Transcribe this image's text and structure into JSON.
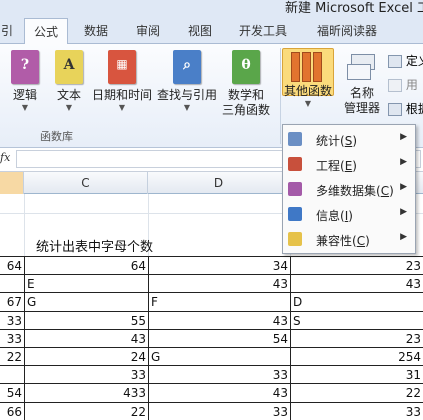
{
  "window": {
    "title": "新建 Microsoft Excel 工"
  },
  "tabs": [
    {
      "label": "引"
    },
    {
      "label": "公式"
    },
    {
      "label": "数据"
    },
    {
      "label": "审阅"
    },
    {
      "label": "视图"
    },
    {
      "label": "开发工具"
    },
    {
      "label": "福昕阅读器"
    }
  ],
  "ribbon": {
    "group_label": "函数库",
    "buttons": [
      {
        "label": "逻辑",
        "icon": "logic-book-icon",
        "glyph": "?"
      },
      {
        "label": "文本",
        "icon": "text-book-icon",
        "glyph": "A"
      },
      {
        "label": "日期和时间",
        "icon": "date-book-icon",
        "glyph": "▦"
      },
      {
        "label": "查找与引用",
        "icon": "lookup-book-icon",
        "glyph": "⌕"
      },
      {
        "label1": "数学和",
        "label2": "三角函数",
        "icon": "math-book-icon",
        "glyph": "θ"
      },
      {
        "label": "其他函数",
        "icon": "more-functions-icon"
      },
      {
        "label1": "名称",
        "label2": "管理器",
        "icon": "name-manager-icon"
      }
    ],
    "side_items": [
      {
        "label": "定义"
      },
      {
        "label": "用"
      },
      {
        "label": "根据"
      }
    ]
  },
  "formula_bar": {
    "fx": "fx",
    "value": ""
  },
  "columns": {
    "c": "C",
    "d": "D"
  },
  "sheet": {
    "heading": "统计出表中字母个数",
    "rows": [
      [
        "64",
        "64",
        "34",
        "23"
      ],
      [
        "",
        "E",
        "43",
        "43"
      ],
      [
        "67",
        "G",
        "F",
        "D"
      ],
      [
        "33",
        "55",
        "43",
        "S"
      ],
      [
        "33",
        "43",
        "54",
        "23"
      ],
      [
        "22",
        "24",
        "G",
        "254"
      ],
      [
        "",
        "33",
        "33",
        "31"
      ],
      [
        "54",
        "433",
        "43",
        "22"
      ],
      [
        "66",
        "22",
        "33",
        "33"
      ]
    ]
  },
  "menu": {
    "items": [
      {
        "label": "统计(",
        "key": "S",
        "tail": ")",
        "icon": "statistics-icon"
      },
      {
        "label": "工程(",
        "key": "E",
        "tail": ")",
        "icon": "engineering-icon"
      },
      {
        "label": "多维数据集(",
        "key": "C",
        "tail": ")",
        "icon": "cube-icon"
      },
      {
        "label": "信息(",
        "key": "I",
        "tail": ")",
        "icon": "information-icon"
      },
      {
        "label": "兼容性(",
        "key": "C",
        "tail": ")",
        "icon": "compatibility-icon"
      }
    ]
  },
  "colors": {
    "accent_tab": "#fbfcfe",
    "highlight_button": "#fbdb7c",
    "selected_column_header": "#f7d9a4"
  }
}
